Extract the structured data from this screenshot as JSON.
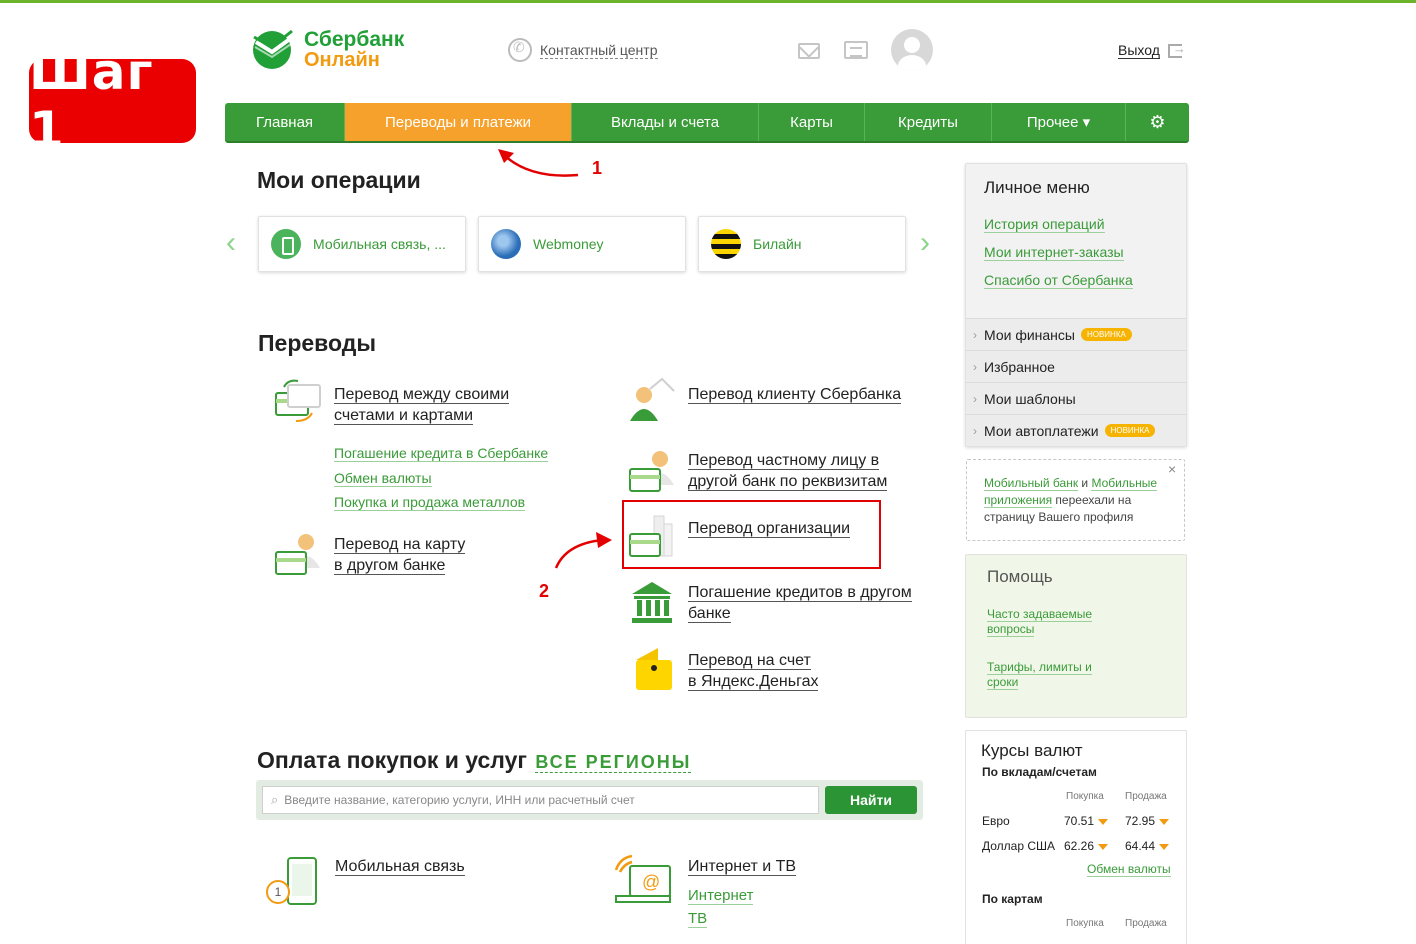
{
  "step_badge": "Шаг 1",
  "header": {
    "logo_line1": "Сбербанк",
    "logo_line2": "Онлайн",
    "contact_center": "Контактный центр",
    "logout": "Выход"
  },
  "nav": {
    "items": [
      {
        "label": "Главная"
      },
      {
        "label": "Переводы и платежи"
      },
      {
        "label": "Вклады и счета"
      },
      {
        "label": "Карты"
      },
      {
        "label": "Кредиты"
      },
      {
        "label": "Прочее ▾"
      },
      {
        "label": "⚙"
      }
    ]
  },
  "annotations": {
    "one": "1",
    "two": "2"
  },
  "my_operations": {
    "title": "Мои операции",
    "cards": [
      {
        "label": "Мобильная связь, ..."
      },
      {
        "label": "Webmoney"
      },
      {
        "label": "Билайн"
      }
    ]
  },
  "transfers": {
    "title": "Переводы",
    "between_own_line1": "Перевод между своими",
    "between_own_line2": "счетами и картами",
    "sub_links": [
      "Погашение кредита в Сбербанке",
      "Обмен валюты",
      "Покупка и продажа металлов"
    ],
    "card_other_bank_line1": "Перевод на карту",
    "card_other_bank_line2": "в другом банке",
    "to_sber_client": "Перевод клиенту Сбербанка",
    "private_person_line1": "Перевод частному лицу в",
    "private_person_line2": "другой банк по реквизитам",
    "organization": "Перевод организации",
    "repay_other_line1": "Погашение кредитов в другом",
    "repay_other_line2": "банке",
    "yandex_line1": "Перевод на счет",
    "yandex_line2": "в Яндекс.Деньгах"
  },
  "payments": {
    "title": "Оплата покупок и услуг",
    "regions": "ВСЕ РЕГИОНЫ",
    "search_placeholder": "Введите название, категорию услуги, ИНН или расчетный счет",
    "search_button": "Найти",
    "mobile": "Мобильная связь",
    "mobile_badge": "1",
    "internet_tv": "Интернет и ТВ",
    "internet": "Интернет",
    "tv": "ТВ"
  },
  "sidebar": {
    "personal_title": "Личное меню",
    "links": [
      "История операций",
      "Мои интернет-заказы",
      "Спасибо от Сбербанка"
    ],
    "items": [
      {
        "label": "Мои финансы",
        "badge": "НОВИНКА"
      },
      {
        "label": "Избранное",
        "badge": ""
      },
      {
        "label": "Мои шаблоны",
        "badge": ""
      },
      {
        "label": "Мои автоплатежи",
        "badge": "НОВИНКА"
      }
    ],
    "notice_link1": "Мобильный банк",
    "notice_and": " и ",
    "notice_link2": "Мобильные приложения",
    "notice_text": " переехали на страницу Вашего профиля",
    "notice_close": "×",
    "help_title": "Помощь",
    "help_faq": "Часто задаваемые вопросы",
    "help_tariffs": "Тарифы, лимиты и сроки",
    "rates_title": "Курсы валют",
    "rates_deposits": "По вкладам/счетам",
    "rates_buy": "Покупка",
    "rates_sell": "Продажа",
    "euro_label": "Евро",
    "euro_buy": "70.51",
    "euro_sell": "72.95",
    "usd_label": "Доллар США",
    "usd_buy": "62.26",
    "usd_sell": "64.44",
    "exchange_link": "Обмен валюты",
    "rates_cards": "По картам",
    "cards_buy": "Покупка",
    "cards_sell": "Продажа"
  },
  "colors": {
    "brand_green": "#3a9b39",
    "active_orange": "#f5a12c",
    "annotation_red": "#e20000"
  }
}
